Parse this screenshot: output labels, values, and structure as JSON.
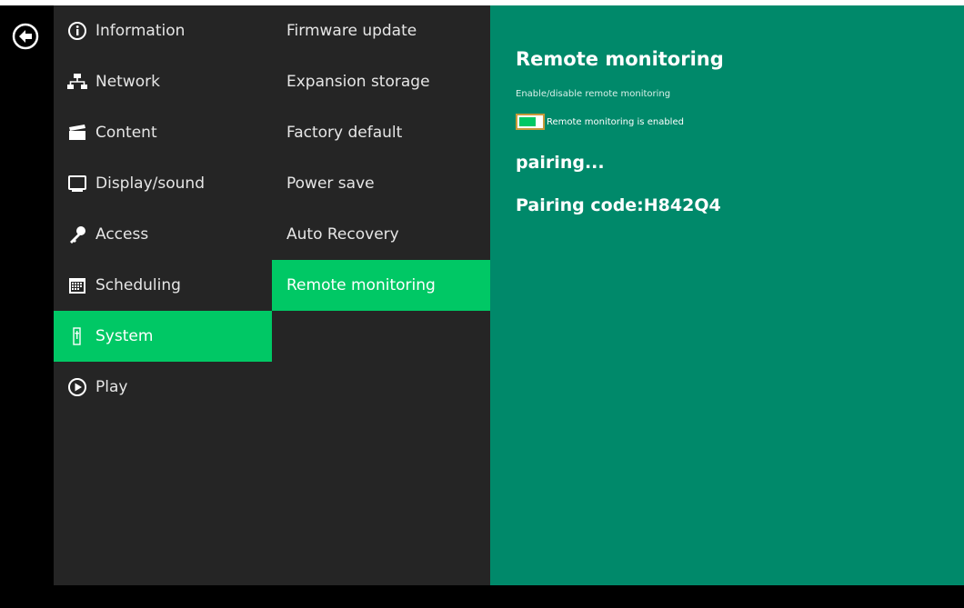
{
  "back": {
    "icon": "back-arrow-icon"
  },
  "menu": {
    "items": [
      {
        "label": "Information",
        "icon": "info-icon",
        "active": false
      },
      {
        "label": "Network",
        "icon": "network-icon",
        "active": false
      },
      {
        "label": "Content",
        "icon": "clapperboard-icon",
        "active": false
      },
      {
        "label": "Display/sound",
        "icon": "monitor-icon",
        "active": false
      },
      {
        "label": "Access",
        "icon": "key-icon",
        "active": false
      },
      {
        "label": "Scheduling",
        "icon": "calendar-icon",
        "active": false
      },
      {
        "label": "System",
        "icon": "system-icon",
        "active": true
      },
      {
        "label": "Play",
        "icon": "play-icon",
        "active": false
      }
    ]
  },
  "submenu": {
    "items": [
      {
        "label": "Firmware update",
        "active": false
      },
      {
        "label": "Expansion storage",
        "active": false
      },
      {
        "label": "Factory default",
        "active": false
      },
      {
        "label": "Power save",
        "active": false
      },
      {
        "label": "Auto Recovery",
        "active": false
      },
      {
        "label": "Remote monitoring",
        "active": true
      }
    ]
  },
  "content": {
    "title": "Remote monitoring",
    "description": "Enable/disable remote monitoring",
    "toggle_label": "Remote monitoring is enabled",
    "toggle_on": true,
    "status": "pairing...",
    "pairing_code_prefix": "Pairing code:",
    "pairing_code": "H842Q4"
  },
  "colors": {
    "sidebar_bg": "#252525",
    "active_green": "#00c865",
    "content_bg": "#00896a"
  }
}
